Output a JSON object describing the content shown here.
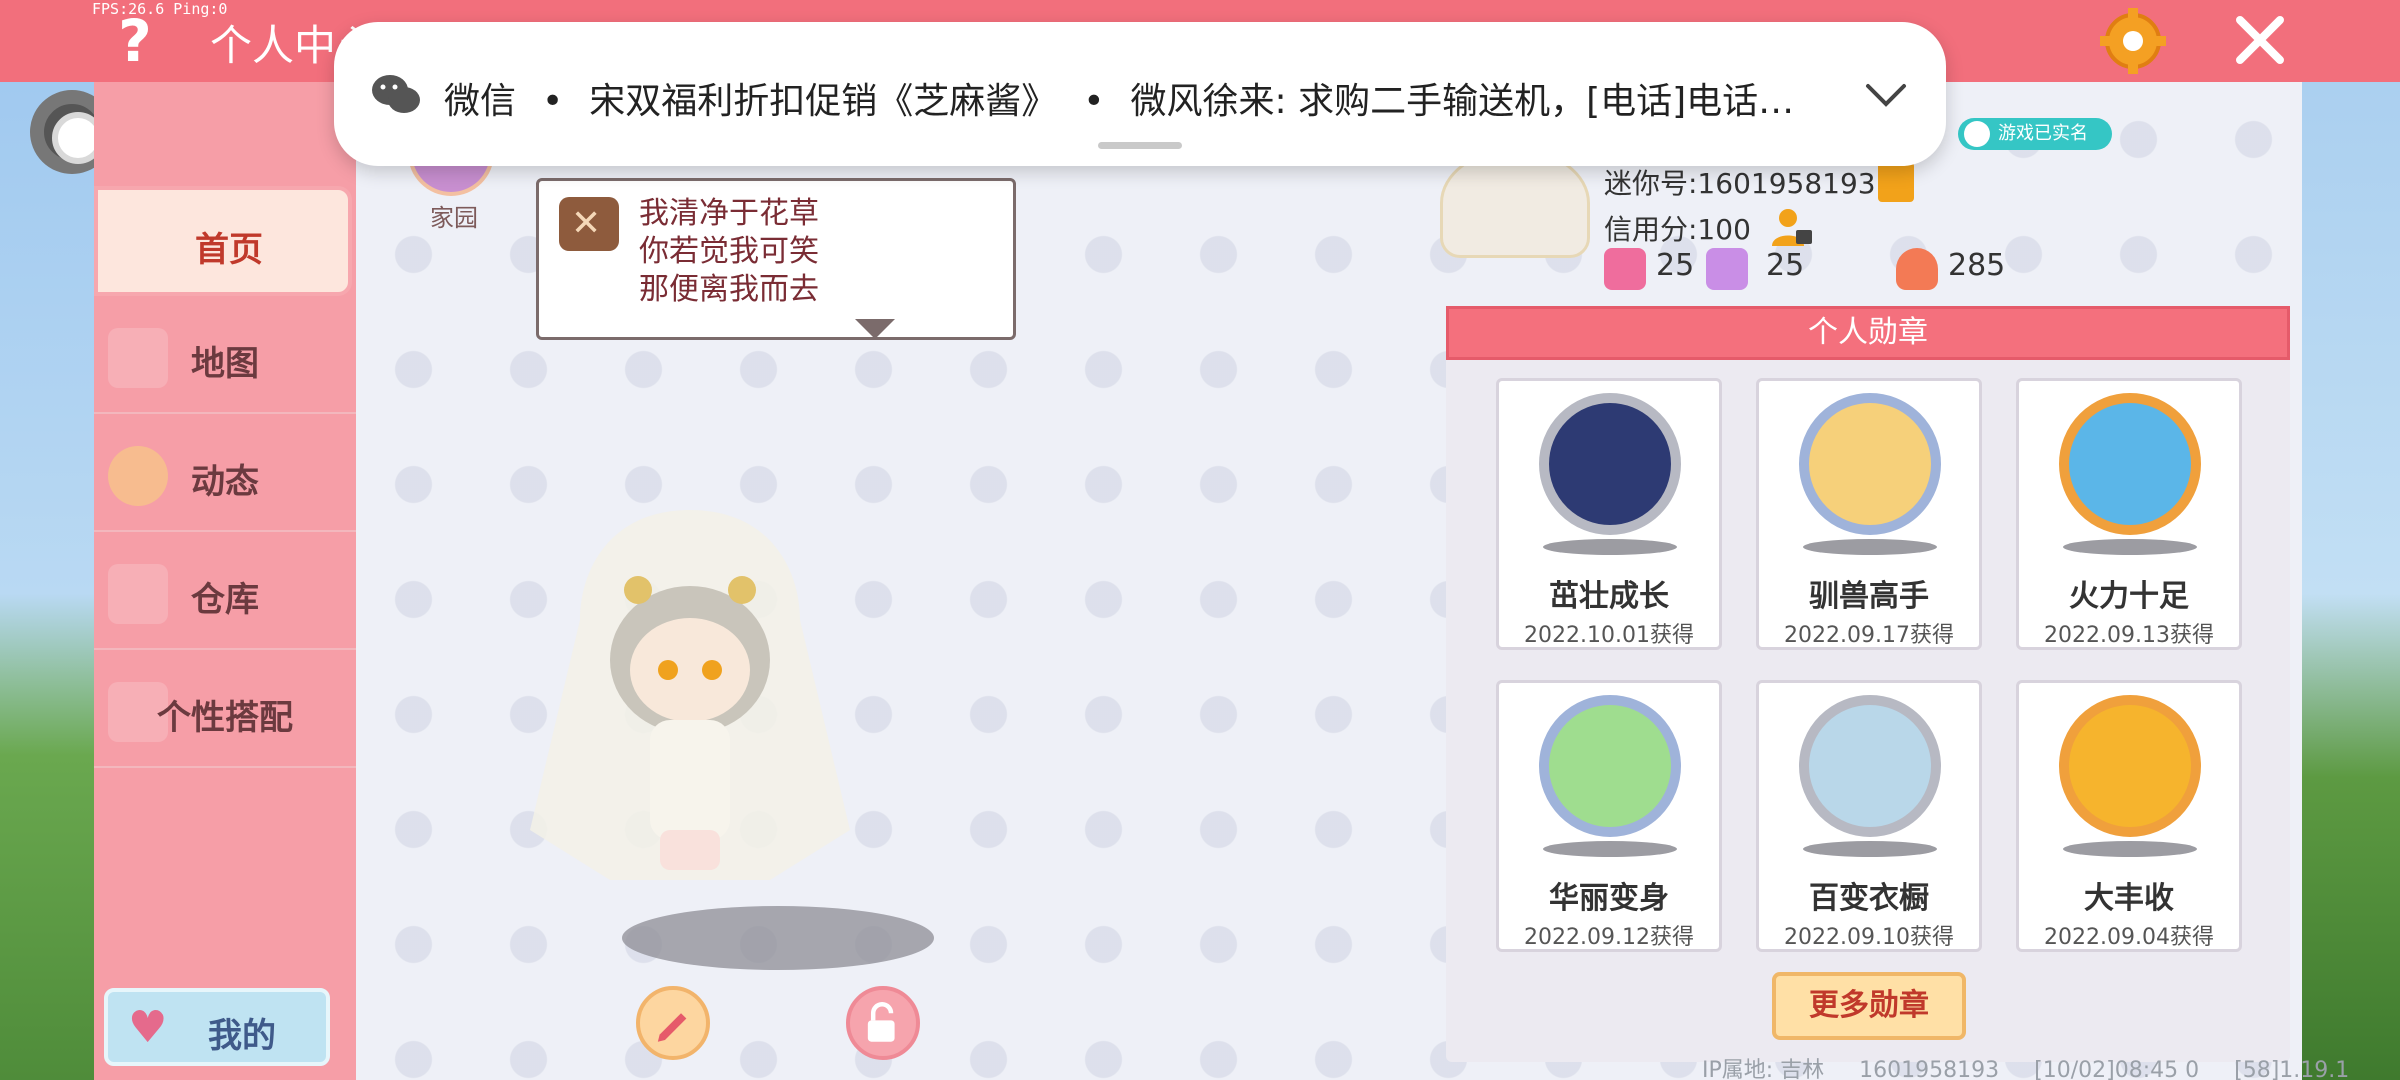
{
  "status": {
    "fps": "FPS:26.6 Ping:0"
  },
  "header": {
    "title": "个人中心"
  },
  "notification": {
    "app": "微信",
    "sep": "•",
    "item1": "宋双福利折扣促销《芝麻酱》",
    "item2": "微风徐来: 求购二手输送机，[电话]电话…"
  },
  "nav": {
    "items": [
      {
        "label": "首页"
      },
      {
        "label": "地图"
      },
      {
        "label": "动态"
      },
      {
        "label": "仓库"
      },
      {
        "label": "个性搭配"
      }
    ],
    "mine_label": "我的"
  },
  "stage": {
    "home_label": "家园",
    "speech_lines": [
      "我清净于花草",
      "你若觉我可笑",
      "那便离我而去"
    ]
  },
  "profile": {
    "realname_badge": "游戏已实名",
    "mini_id": "迷你号:1601958193",
    "credit": "信用分:100",
    "stats": [
      "25",
      "25",
      "285"
    ]
  },
  "medals": {
    "title": "个人勋章",
    "items": [
      {
        "name": "茁壮成长",
        "date": "2022.10.01获得"
      },
      {
        "name": "驯兽高手",
        "date": "2022.09.17获得"
      },
      {
        "name": "火力十足",
        "date": "2022.09.13获得"
      },
      {
        "name": "华丽变身",
        "date": "2022.09.12获得"
      },
      {
        "name": "百变衣橱",
        "date": "2022.09.10获得"
      },
      {
        "name": "大丰收",
        "date": "2022.09.04获得"
      }
    ],
    "more_label": "更多勋章"
  },
  "footer": {
    "ip": "IP属地: 吉林",
    "uid": "1601958193",
    "time": "[10/02]08:45 0",
    "version": "[58]1.19.1"
  },
  "colors": {
    "accent": "#f26f7c",
    "nav_bg": "#f69ea7",
    "stage_bg": "#eef0f7"
  }
}
